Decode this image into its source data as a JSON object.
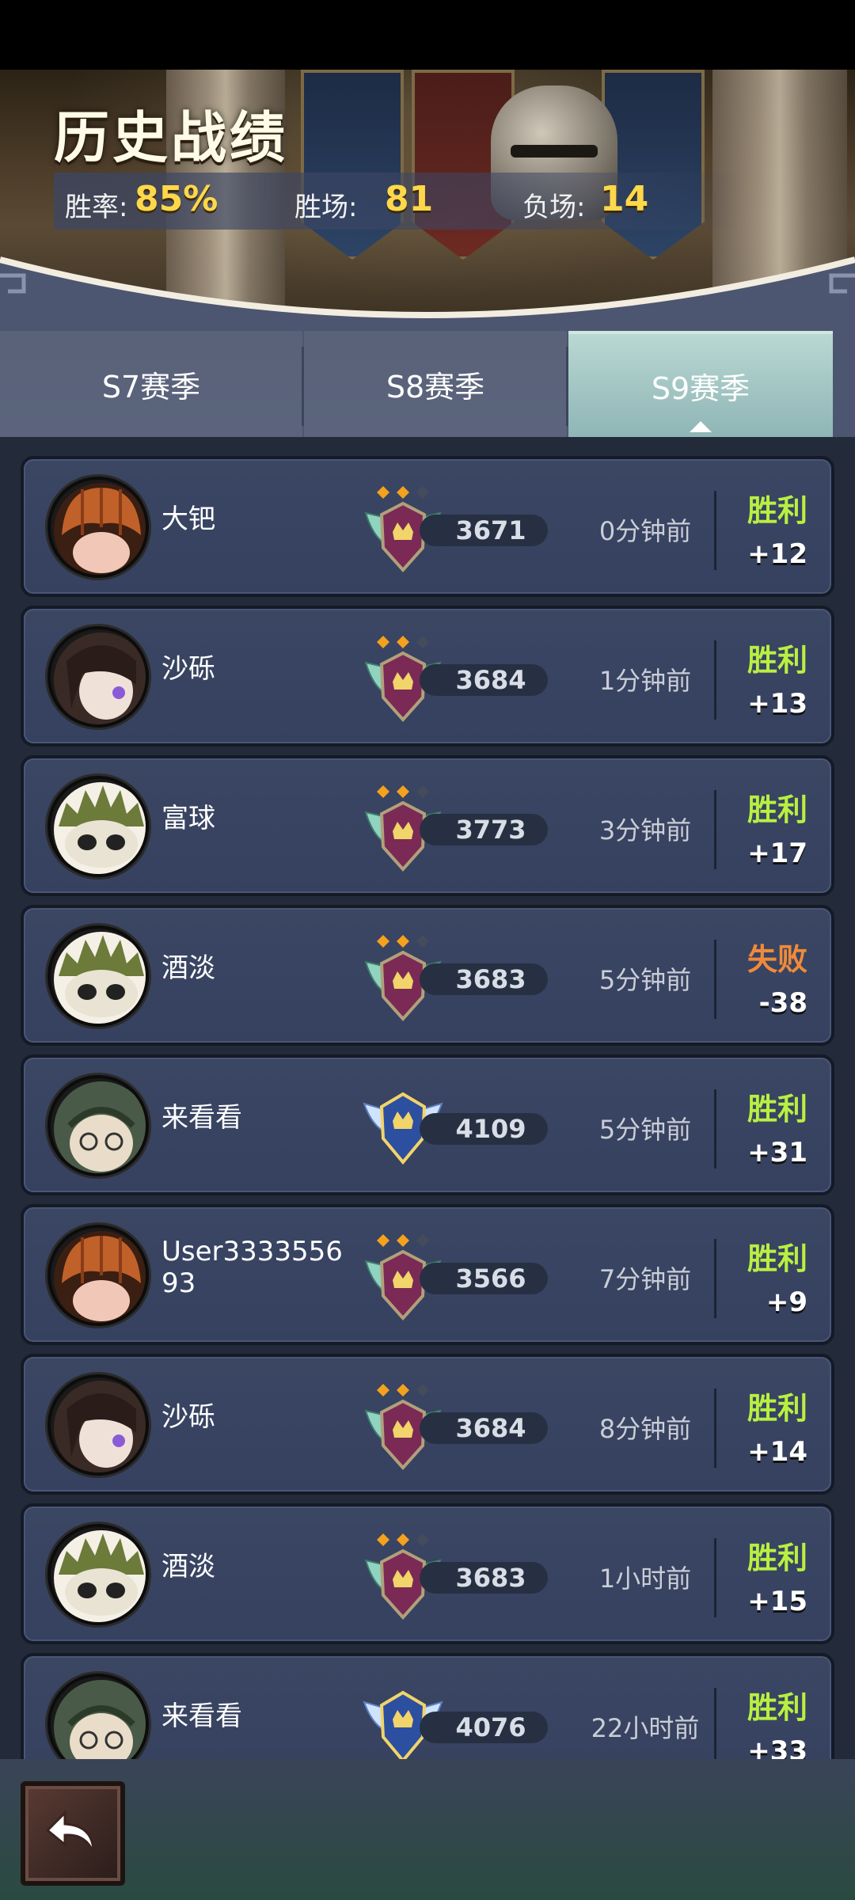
{
  "header": {
    "title": "历史战绩",
    "win_rate_label": "胜率:",
    "win_rate_value": "85%",
    "wins_label": "胜场:",
    "wins_value": "81",
    "losses_label": "负场:",
    "losses_value": "14"
  },
  "tabs": [
    {
      "label": "S7赛季",
      "active": false
    },
    {
      "label": "S8赛季",
      "active": false
    },
    {
      "label": "S9赛季",
      "active": true
    }
  ],
  "colors": {
    "win": "#b8f041",
    "loss": "#f08a3a",
    "gold": "#ffd84a"
  },
  "matches": [
    {
      "name": "大钯",
      "avatar": "pumpkin-avatar",
      "badge": "crown-shield-badge",
      "score": "3671",
      "time": "0分钟前",
      "result": "胜利",
      "delta": "+12",
      "win": true
    },
    {
      "name": "沙砾",
      "avatar": "dark-hair-avatar",
      "badge": "crown-shield-badge",
      "score": "3684",
      "time": "1分钟前",
      "result": "胜利",
      "delta": "+13",
      "win": true
    },
    {
      "name": "富球",
      "avatar": "spiky-avatar",
      "badge": "crown-shield-badge",
      "score": "3773",
      "time": "3分钟前",
      "result": "胜利",
      "delta": "+17",
      "win": true
    },
    {
      "name": "酒淡",
      "avatar": "spiky-avatar",
      "badge": "crown-shield-badge",
      "score": "3683",
      "time": "5分钟前",
      "result": "失败",
      "delta": "-38",
      "win": false
    },
    {
      "name": "来看看",
      "avatar": "hood-avatar",
      "badge": "winged-badge",
      "score": "4109",
      "time": "5分钟前",
      "result": "胜利",
      "delta": "+31",
      "win": true
    },
    {
      "name": "User333355693",
      "avatar": "pumpkin-avatar",
      "badge": "crown-shield-badge",
      "score": "3566",
      "time": "7分钟前",
      "result": "胜利",
      "delta": "+9",
      "win": true
    },
    {
      "name": "沙砾",
      "avatar": "dark-hair-avatar",
      "badge": "crown-shield-badge",
      "score": "3684",
      "time": "8分钟前",
      "result": "胜利",
      "delta": "+14",
      "win": true
    },
    {
      "name": "酒淡",
      "avatar": "spiky-avatar",
      "badge": "crown-shield-badge",
      "score": "3683",
      "time": "1小时前",
      "result": "胜利",
      "delta": "+15",
      "win": true
    },
    {
      "name": "来看看",
      "avatar": "hood-avatar",
      "badge": "winged-badge",
      "score": "4076",
      "time": "22小时前",
      "result": "胜利",
      "delta": "+33",
      "win": true
    }
  ],
  "footer": {
    "back_icon": "back-arrow-icon"
  }
}
